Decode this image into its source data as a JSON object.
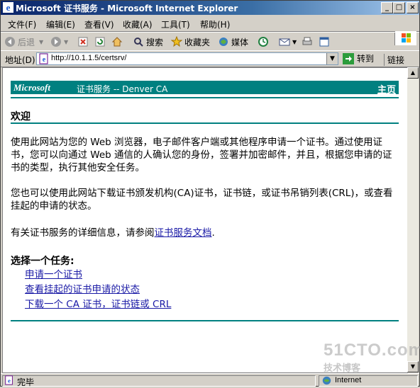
{
  "window": {
    "title": "Microsoft 证书服务 - Microsoft Internet Explorer",
    "min_label": "_",
    "max_label": "□",
    "close_label": "×"
  },
  "menu": [
    "文件(F)",
    "编辑(E)",
    "查看(V)",
    "收藏(A)",
    "工具(T)",
    "帮助(H)"
  ],
  "toolbar": {
    "back": "后退",
    "search": "搜索",
    "favorites": "收藏夹",
    "media": "媒体"
  },
  "address": {
    "label": "地址(D)",
    "url": "http://10.1.1.5/certsrv/",
    "go": "转到",
    "links": "链接"
  },
  "page": {
    "brand": "Microsoft",
    "service": "证书服务 --  Denver CA",
    "home_link": "主页",
    "welcome": "欢迎",
    "para1": "使用此网站为您的 Web 浏览器，电子邮件客户端或其他程序申请一个证书。通过使用证书，您可以向通过 Web 通信的人确认您的身份，签署并加密邮件，并且，根据您申请的证书的类型，执行其他安全任务。",
    "para2": "您也可以使用此网站下载证书颁发机构(CA)证书，证书链，或证书吊销列表(CRL)，或查看挂起的申请的状态。",
    "para3_prefix": "有关证书服务的详细信息，请参阅",
    "para3_link": "证书服务文档",
    "para3_suffix": ".",
    "task_heading": "选择一个任务:",
    "tasks": [
      "申请一个证书",
      "查看挂起的证书申请的状态",
      "下载一个 CA 证书，证书链或 CRL"
    ]
  },
  "status": {
    "left": "完毕",
    "zone": "Internet"
  },
  "watermark": {
    "line1": "51CTO.com",
    "line2": "技术博客"
  },
  "colors": {
    "titlebar": "#0a246a",
    "ca_bar": "#008080",
    "link": "#1a1aa6"
  }
}
